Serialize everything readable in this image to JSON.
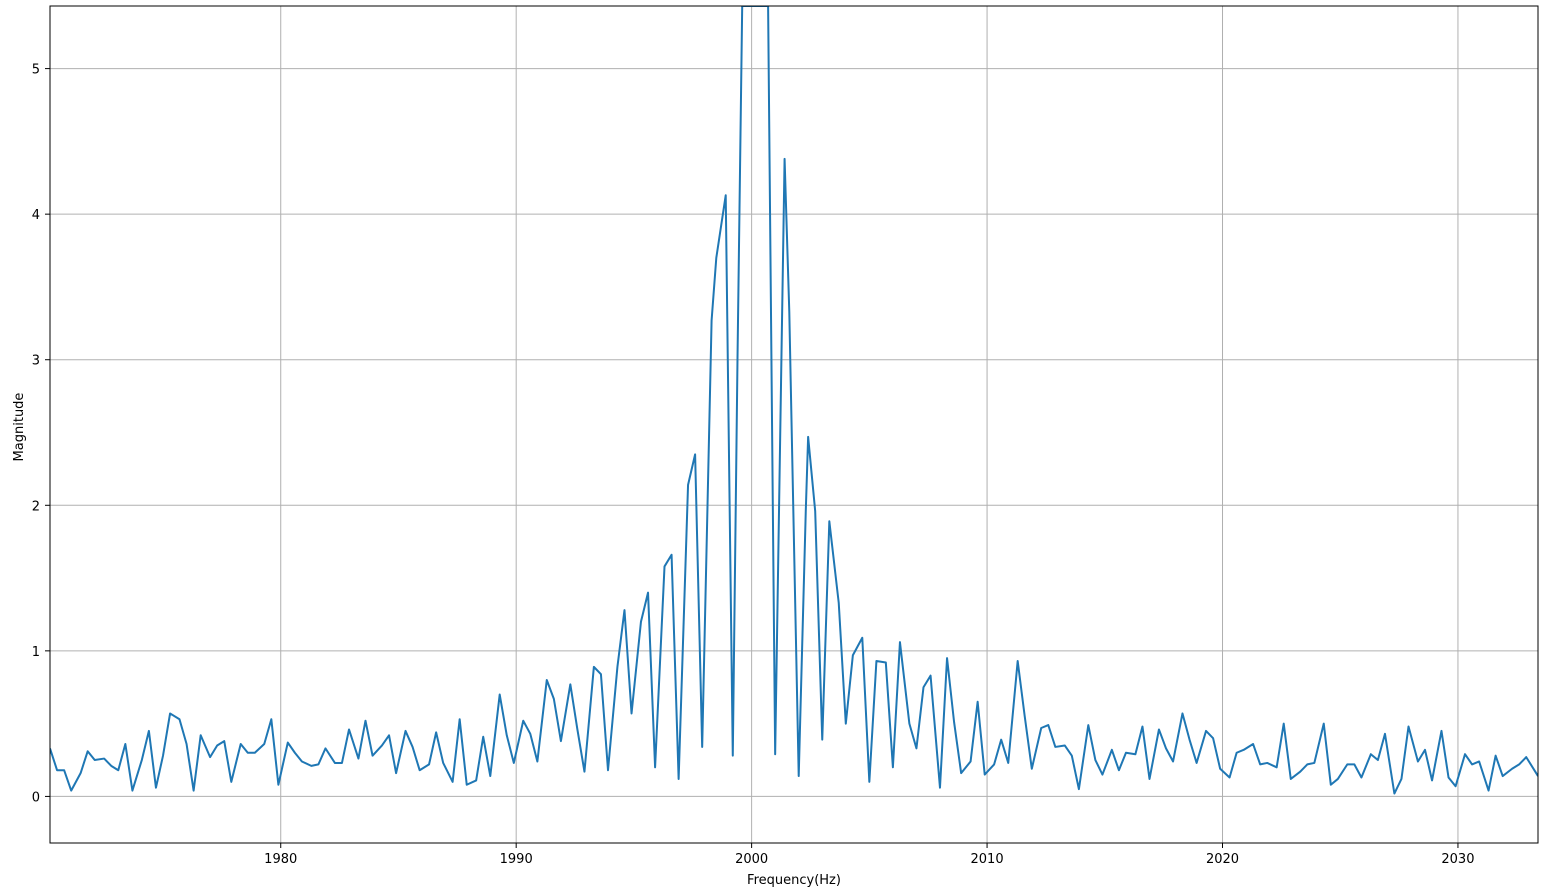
{
  "chart_data": {
    "type": "line",
    "title": "",
    "xlabel": "Frequency(Hz)",
    "ylabel": "Magnitude",
    "xlim": [
      1970.2,
      2033.4
    ],
    "ylim": [
      -0.32,
      5.43
    ],
    "xticks": [
      1980,
      1990,
      2000,
      2010,
      2020,
      2030
    ],
    "yticks": [
      0,
      1,
      2,
      3,
      4,
      5
    ],
    "grid": true,
    "color": "#1f77b4",
    "series": [
      {
        "x": [
          1970.2,
          1970.5,
          1970.8,
          1971.1,
          1971.5,
          1971.8,
          1972.1,
          1972.5,
          1972.8,
          1973.1,
          1973.4,
          1973.7,
          1974.1,
          1974.4,
          1974.7,
          1975.0,
          1975.3,
          1975.7,
          1976.0,
          1976.3,
          1976.6,
          1977.0,
          1977.3,
          1977.6,
          1977.9,
          1978.3,
          1978.6,
          1978.9,
          1979.3,
          1979.6,
          1979.9,
          1980.3,
          1980.6,
          1980.9,
          1981.3,
          1981.6,
          1981.9,
          1982.3,
          1982.6,
          1982.9,
          1983.3,
          1983.6,
          1983.9,
          1984.3,
          1984.6,
          1984.9,
          1985.3,
          1985.6,
          1985.9,
          1986.3,
          1986.6,
          1986.9,
          1987.3,
          1987.6,
          1987.9,
          1988.3,
          1988.6,
          1988.9,
          1989.3,
          1989.6,
          1989.9,
          1990.3,
          1990.6,
          1990.9,
          1991.3,
          1991.6,
          1991.9,
          1992.3,
          1992.6,
          1992.9,
          1993.3,
          1993.6,
          1993.9,
          1994.3,
          1994.6,
          1994.9,
          1995.3,
          1995.6,
          1995.9,
          1996.3,
          1996.6,
          1996.9,
          1997.3,
          1997.6,
          1997.9,
          1998.3,
          1998.5,
          1998.9,
          1999.2,
          1999.4,
          1999.6,
          2000.0,
          2000.4,
          2000.7,
          2001.0,
          2001.4,
          2001.6,
          2002.0,
          2002.3,
          2002.4,
          2002.7,
          2003.0,
          2003.3,
          2003.7,
          2004.0,
          2004.3,
          2004.7,
          2005.0,
          2005.3,
          2005.7,
          2006.0,
          2006.3,
          2006.7,
          2007.0,
          2007.3,
          2007.6,
          2008.0,
          2008.3,
          2008.6,
          2008.9,
          2009.3,
          2009.6,
          2009.9,
          2010.3,
          2010.6,
          2010.9,
          2011.3,
          2011.6,
          2011.9,
          2012.3,
          2012.6,
          2012.9,
          2013.3,
          2013.6,
          2013.9,
          2014.3,
          2014.6,
          2014.9,
          2015.3,
          2015.6,
          2015.9,
          2016.3,
          2016.6,
          2016.9,
          2017.3,
          2017.6,
          2017.9,
          2018.3,
          2018.6,
          2018.9,
          2019.3,
          2019.6,
          2019.9,
          2020.3,
          2020.6,
          2020.9,
          2021.3,
          2021.6,
          2021.9,
          2022.3,
          2022.6,
          2022.9,
          2023.3,
          2023.6,
          2023.9,
          2024.3,
          2024.6,
          2024.9,
          2025.3,
          2025.6,
          2025.9,
          2026.3,
          2026.6,
          2026.9,
          2027.3,
          2027.6,
          2027.9,
          2028.3,
          2028.6,
          2028.9,
          2029.3,
          2029.6,
          2029.9,
          2030.3,
          2030.6,
          2030.9,
          2031.3,
          2031.6,
          2031.9,
          2032.3,
          2032.6,
          2032.9,
          2033.4
        ],
        "y": [
          0.33,
          0.18,
          0.18,
          0.04,
          0.16,
          0.31,
          0.25,
          0.26,
          0.21,
          0.18,
          0.36,
          0.04,
          0.25,
          0.45,
          0.06,
          0.28,
          0.57,
          0.53,
          0.36,
          0.04,
          0.42,
          0.27,
          0.35,
          0.38,
          0.1,
          0.36,
          0.3,
          0.3,
          0.36,
          0.53,
          0.08,
          0.37,
          0.3,
          0.24,
          0.21,
          0.22,
          0.33,
          0.23,
          0.23,
          0.46,
          0.26,
          0.52,
          0.28,
          0.35,
          0.42,
          0.16,
          0.45,
          0.34,
          0.18,
          0.22,
          0.44,
          0.23,
          0.1,
          0.53,
          0.08,
          0.11,
          0.41,
          0.14,
          0.7,
          0.42,
          0.23,
          0.52,
          0.43,
          0.24,
          0.8,
          0.67,
          0.38,
          0.77,
          0.46,
          0.17,
          0.89,
          0.84,
          0.18,
          0.89,
          1.28,
          0.57,
          1.2,
          1.4,
          0.2,
          1.58,
          1.66,
          0.12,
          2.14,
          2.35,
          0.34,
          3.27,
          3.7,
          4.13,
          0.28,
          3.0,
          5.43,
          5.43,
          5.43,
          5.43,
          0.29,
          4.38,
          3.33,
          0.14,
          1.96,
          2.47,
          1.96,
          0.39,
          1.89,
          1.33,
          0.5,
          0.97,
          1.09,
          0.1,
          0.93,
          0.92,
          0.2,
          1.06,
          0.5,
          0.33,
          0.75,
          0.83,
          0.06,
          0.95,
          0.51,
          0.16,
          0.24,
          0.65,
          0.15,
          0.22,
          0.39,
          0.23,
          0.93,
          0.55,
          0.19,
          0.47,
          0.49,
          0.34,
          0.35,
          0.28,
          0.05,
          0.49,
          0.25,
          0.15,
          0.32,
          0.18,
          0.3,
          0.29,
          0.48,
          0.12,
          0.46,
          0.33,
          0.24,
          0.57,
          0.39,
          0.23,
          0.45,
          0.4,
          0.19,
          0.13,
          0.3,
          0.32,
          0.36,
          0.22,
          0.23,
          0.2,
          0.5,
          0.12,
          0.17,
          0.22,
          0.23,
          0.5,
          0.08,
          0.12,
          0.22,
          0.22,
          0.13,
          0.29,
          0.25,
          0.43,
          0.02,
          0.12,
          0.48,
          0.24,
          0.32,
          0.11,
          0.45,
          0.13,
          0.07,
          0.29,
          0.22,
          0.24,
          0.04,
          0.28,
          0.14,
          0.19,
          0.22,
          0.27,
          0.14
        ]
      }
    ]
  }
}
